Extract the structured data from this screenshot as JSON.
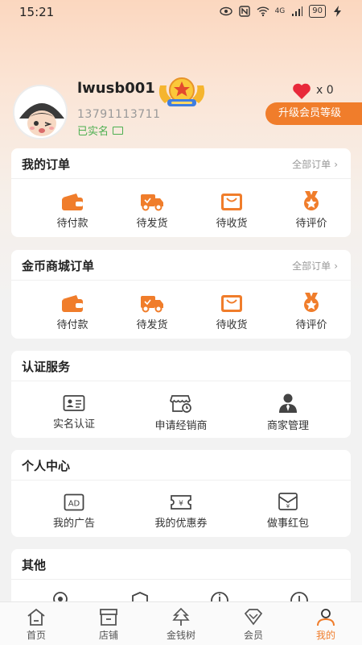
{
  "status_bar": {
    "time": "15:21",
    "network": "4G",
    "battery": "90"
  },
  "profile": {
    "username": "lwusb001",
    "phone": "13791113711",
    "verified_text": "已实名",
    "likes_prefix": "x",
    "likes_count": "0",
    "upgrade_label": "升级会员等级"
  },
  "orders": {
    "title": "我的订单",
    "more_label": "全部订单",
    "items": [
      {
        "label": "待付款",
        "icon": "wallet-icon"
      },
      {
        "label": "待发货",
        "icon": "truck-icon"
      },
      {
        "label": "待收货",
        "icon": "box-icon"
      },
      {
        "label": "待评价",
        "icon": "medal-icon"
      }
    ]
  },
  "coin_orders": {
    "title": "金币商城订单",
    "more_label": "全部订单",
    "items": [
      {
        "label": "待付款",
        "icon": "wallet-icon"
      },
      {
        "label": "待发货",
        "icon": "truck-icon"
      },
      {
        "label": "待收货",
        "icon": "box-icon"
      },
      {
        "label": "待评价",
        "icon": "medal-icon"
      }
    ]
  },
  "certification": {
    "title": "认证服务",
    "items": [
      {
        "label": "实名认证",
        "icon": "id-card-icon"
      },
      {
        "label": "申请经销商",
        "icon": "store-icon"
      },
      {
        "label": "商家管理",
        "icon": "person-icon"
      }
    ]
  },
  "personal": {
    "title": "个人中心",
    "items": [
      {
        "label": "我的广告",
        "icon": "ad-icon"
      },
      {
        "label": "我的优惠券",
        "icon": "coupon-icon"
      },
      {
        "label": "做事红包",
        "icon": "red-envelope-icon"
      }
    ]
  },
  "other": {
    "title": "其他"
  },
  "nav": [
    {
      "label": "首页",
      "icon": "home-icon"
    },
    {
      "label": "店铺",
      "icon": "shop-icon"
    },
    {
      "label": "金钱树",
      "icon": "tree-icon"
    },
    {
      "label": "会员",
      "icon": "diamond-icon"
    },
    {
      "label": "我的",
      "icon": "user-icon",
      "active": true
    }
  ],
  "colors": {
    "accent": "#f07d2b",
    "verified": "#4caf50",
    "heart": "#e8293a"
  }
}
